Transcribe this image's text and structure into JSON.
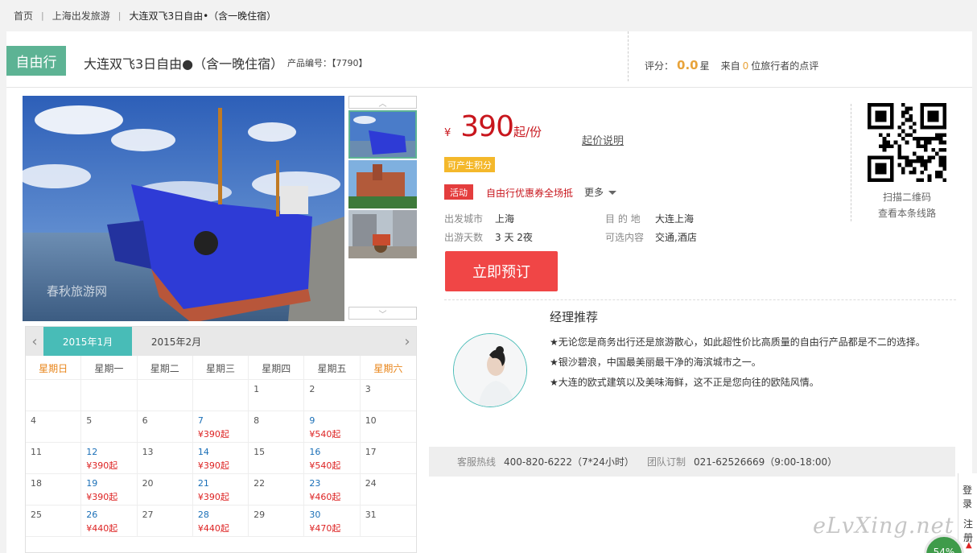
{
  "breadcrumb": [
    "首页",
    "上海出发旅游",
    "大连双飞3日自由•（含一晚住宿）"
  ],
  "product": {
    "tag": "自由行",
    "title": "大连双飞3日自由●（含一晚住宿）",
    "code": "产品编号：【7790】"
  },
  "rating": {
    "label": "评分：",
    "score": "0.0",
    "unit": "星",
    "from": "来自",
    "count": "0",
    "suffix": "位旅行者的点评"
  },
  "gallery": {
    "watermark": "春秋旅游网 springtour.com",
    "thumb_count": 3
  },
  "calendar": {
    "months": [
      "2015年1月",
      "2015年2月"
    ],
    "active_month_index": 0,
    "weekdays": [
      "星期日",
      "星期一",
      "星期二",
      "星期三",
      "星期四",
      "星期五",
      "星期六"
    ],
    "weeks": [
      [
        {
          "d": ""
        },
        {
          "d": ""
        },
        {
          "d": ""
        },
        {
          "d": ""
        },
        {
          "d": "1"
        },
        {
          "d": "2"
        },
        {
          "d": "3"
        }
      ],
      [
        {
          "d": "4"
        },
        {
          "d": "5"
        },
        {
          "d": "6"
        },
        {
          "d": "7",
          "p": "¥390起"
        },
        {
          "d": "8"
        },
        {
          "d": "9",
          "p": "¥540起"
        },
        {
          "d": "10"
        }
      ],
      [
        {
          "d": "11"
        },
        {
          "d": "12",
          "p": "¥390起"
        },
        {
          "d": "13"
        },
        {
          "d": "14",
          "p": "¥390起"
        },
        {
          "d": "15"
        },
        {
          "d": "16",
          "p": "¥540起"
        },
        {
          "d": "17"
        }
      ],
      [
        {
          "d": "18"
        },
        {
          "d": "19",
          "p": "¥390起"
        },
        {
          "d": "20"
        },
        {
          "d": "21",
          "p": "¥390起"
        },
        {
          "d": "22"
        },
        {
          "d": "23",
          "p": "¥460起"
        },
        {
          "d": "24"
        }
      ],
      [
        {
          "d": "25"
        },
        {
          "d": "26",
          "p": "¥440起"
        },
        {
          "d": "27"
        },
        {
          "d": "28",
          "p": "¥440起"
        },
        {
          "d": "29"
        },
        {
          "d": "30",
          "p": "¥470起"
        },
        {
          "d": "31"
        }
      ]
    ]
  },
  "booking": {
    "currency": "¥",
    "price": "390",
    "per": "起/份",
    "price_note": "起价说明",
    "points_badge": "可产生积分",
    "activity_badge": "活动",
    "activity_text": "自由行优惠券全场抵",
    "more": "更多",
    "departure_label": "出发城市",
    "departure": "上海",
    "destination_label": "目 的 地",
    "destination": "大连上海",
    "days_label": "出游天数",
    "days": "3 天 2夜",
    "options_label": "可选内容",
    "options": "交通,酒店",
    "book_button": "立即预订"
  },
  "qr": {
    "line1": "扫描二维码",
    "line2": "查看本条线路"
  },
  "manager": {
    "title": "经理推荐",
    "lines": [
      "★无论您是商务出行还是旅游散心，如此超性价比高质量的自由行产品都是不二的选择。",
      "★银沙碧浪，中国最美丽最干净的海滨城市之一。",
      "★大连的欧式建筑以及美味海鲜，这不正是您向往的欧陆风情。"
    ]
  },
  "contact": {
    "hotline_label": "客服热线",
    "hotline": "400-820-6222（7*24小时）",
    "group_label": "团队订制",
    "group": "021-62526669（9:00-18:00）"
  },
  "side": {
    "login": "登录",
    "register": "注册",
    "progress": "54%",
    "watermark": "eLvXing.net"
  },
  "colors": {
    "brand_green": "#5db394",
    "teal": "#48bcb7",
    "price_red": "#c8161d",
    "button_red": "#f04646",
    "badge_orange": "#f4b82b"
  }
}
